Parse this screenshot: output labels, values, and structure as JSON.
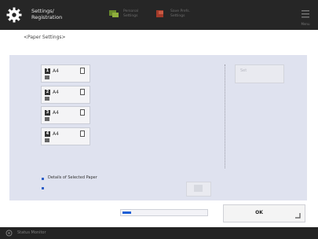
{
  "header": {
    "title_line1": "Settings/",
    "title_line2": "Registration",
    "item1_line1": "Personal",
    "item1_line2": "Settings",
    "item2_line1": "Save Prefs.",
    "item2_line2": "Settings",
    "menu_label": "Menu"
  },
  "page": {
    "heading": "<Paper Settings>"
  },
  "drawers": [
    {
      "number": "1",
      "size": "A4"
    },
    {
      "number": "2",
      "size": "A4"
    },
    {
      "number": "3",
      "size": "A4"
    },
    {
      "number": "4",
      "size": "A4"
    }
  ],
  "set_button": {
    "label": "Set"
  },
  "details": {
    "label": "Details of Selected Paper"
  },
  "progress": {
    "fraction": 0.1
  },
  "ok_button": {
    "label": "OK"
  },
  "status_bar": {
    "label": "Status Monitor"
  },
  "colors": {
    "accent": "#1d5fd6",
    "panel": "#dfe2ef",
    "bar": "#262626"
  }
}
